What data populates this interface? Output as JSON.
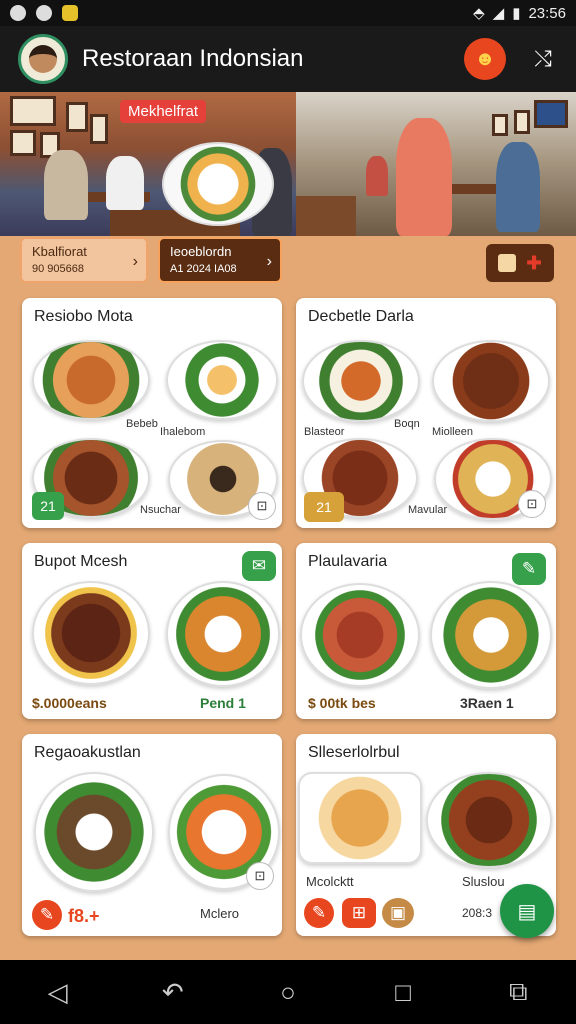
{
  "status": {
    "time": "23:56"
  },
  "header": {
    "title": "Restoraan Indonsian"
  },
  "hero": {
    "sign": "Mekhelfrat"
  },
  "chips": [
    {
      "line1": "Kbalfiorat",
      "line2": "90   905668",
      "arrow": "›"
    },
    {
      "line1": "Ieoeblordn",
      "line2": "A1   2024 IA08",
      "arrow": "›"
    }
  ],
  "cards": [
    {
      "title": "Resiobo Mota",
      "labels": [
        "Bebeb",
        "Ihalebom"
      ],
      "side_label": "Nsuchar",
      "badge": "21"
    },
    {
      "title": "Decbetle Darla",
      "labels": [
        "Blasteor",
        "Boqn",
        "Miolleen"
      ],
      "side_label": "Mavular",
      "badge": "21"
    },
    {
      "title": "Bupot Mcesh",
      "price": "$.0000eans",
      "price2": "Pend 1"
    },
    {
      "title": "Plaulavaria",
      "price": "$ 00tk bes",
      "price2": "3Raen 1"
    },
    {
      "title": "Regaoakustlan",
      "price": "f8.+",
      "side_label": "Mclero"
    },
    {
      "title": "Slleserlolrbul",
      "labels": [
        "Mcolcktt",
        "Sluslou"
      ],
      "price2": "208:3"
    }
  ],
  "colors": {
    "accent": "#e8461f",
    "green": "#36a04a",
    "bg": "#e3a874"
  }
}
